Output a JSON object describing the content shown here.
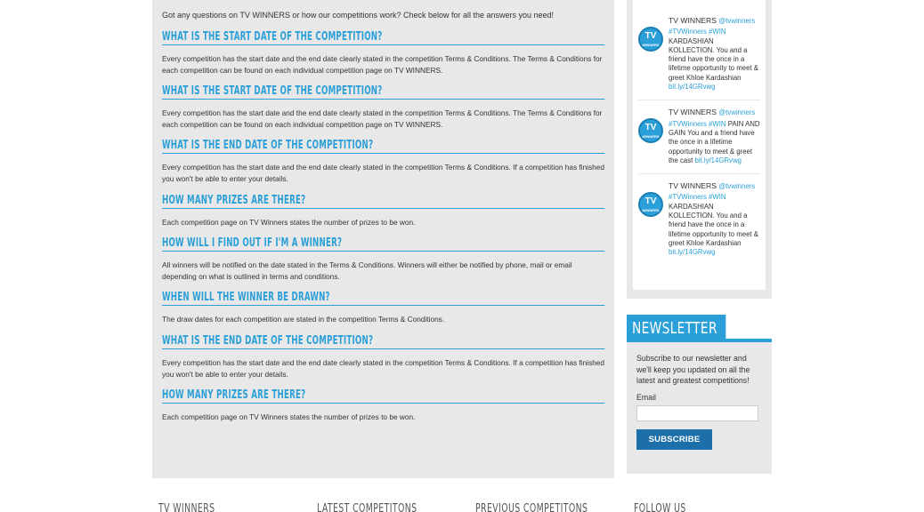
{
  "faq": {
    "intro": "Got any questions on TV WINNERS or how our competitions work? Check below for all the answers you need!",
    "items": [
      {
        "q": "What is the start date of the competition?",
        "a": "Every competition has the start date and the end date clearly stated in the competition Terms & Conditions. The Terms & Conditions for each competition can be found on each individual competition page on TV WINNERS."
      },
      {
        "q": "What is the start date of the competition?",
        "a": "Every competition has the start date and the end date clearly stated in the competition Terms & Conditions. The Terms & Conditions for each competition can be found on each individual competition page on TV WINNERS."
      },
      {
        "q": "What is the end date of the competition?",
        "a": "Every competition has the start date and the end date clearly stated in the competition Terms & Conditions. If a competition has finished you won't be able to enter your details."
      },
      {
        "q": "How many prizes are there?",
        "a": "Each competition page on TV Winners states the number of prizes to be won."
      },
      {
        "q": "How will I find out if I'm a winner?",
        "a": "All winners will be notified on the date stated in the Terms & Conditions. Winners will either be notified by phone, mail or email depending on what is outlined in terms and conditions."
      },
      {
        "q": "When will the winner be drawn?",
        "a": "The draw dates for each competition are stated in the competition Terms & Conditions."
      },
      {
        "q": "What is the end date of the competition?",
        "a": "Every competition has the start date and the end date clearly stated in the competition Terms & Conditions. If a competition has finished you won't be able to enter your details."
      },
      {
        "q": "How many prizes are there?",
        "a": "Each competition page on TV Winners states the number of prizes to be won."
      }
    ]
  },
  "tweets": [
    {
      "avatar": "TV",
      "avatar_sub": "WINNERS",
      "name": "TV WINNERS",
      "handle": "@tvwinners",
      "tags": "#TVWinners #WIN",
      "text": "KARDASHIAN KOLLECTION. You and a friend have the once in a lifetime opportunity to meet & greet Khloe Kardashian",
      "link": "bit.ly/14GRvwg"
    },
    {
      "avatar": "TV",
      "avatar_sub": "WINNERS",
      "name": "TV WINNERS",
      "handle": "@tvwinners",
      "tags": "#TVWinners #WIN",
      "text": "PAIN AND GAIN You and a friend have the once in a lifetime opportunity to meet & greet the cast",
      "link": "bit.ly/14GRvwg"
    },
    {
      "avatar": "TV",
      "avatar_sub": "WINNERS",
      "name": "TV WINNERS",
      "handle": "@tvwinners",
      "tags": "#TVWinners #WIN",
      "text": "KARDASHIAN KOLLECTION. You and a friend have the once in a lifetime opportunity to meet & greet Khloe Kardashian",
      "link": "bit.ly/14GRvwg"
    }
  ],
  "newsletter": {
    "title": "NEWSLETTER",
    "text": "Subscribe to our newsletter and we'll keep you updated on all the latest and greatest competitions!",
    "email_label": "Email",
    "email_value": "",
    "button": "SUBSCRIBE"
  },
  "footer": {
    "headings": [
      "TV WINNERS",
      "LATEST COMPETITONS",
      "PREVIOUS COMPETITONS",
      "FOLLOW US"
    ]
  },
  "colors": {
    "accent": "#2a9fd8",
    "panel": "#e8e8e8",
    "button": "#1c6fa8"
  }
}
